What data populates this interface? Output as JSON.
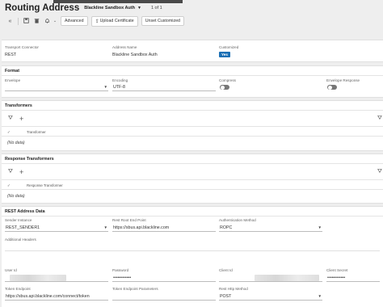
{
  "header": {
    "title": "Routing Address",
    "selector": "Blackline Sandbox Auth",
    "pager": "1 of 1"
  },
  "toolbar": {
    "back_icon": "chevron-double-left-icon",
    "save_icon": "save-icon",
    "delete_icon": "trash-icon",
    "bell_icon": "bell-icon",
    "advanced": "Advanced",
    "upload": "Upload Certificate",
    "unset": "Unset Customized"
  },
  "general": {
    "transport_connector_label": "Transport Connector",
    "transport_connector_value": "REST",
    "address_name_label": "Address Name",
    "address_name_value": "Blackline Sandbox Auth",
    "customized_label": "Customized",
    "customized_value": "Yes"
  },
  "format": {
    "title": "Format",
    "envelope_label": "Envelope",
    "envelope_value": "",
    "encoding_label": "Encoding",
    "encoding_value": "UTF-8",
    "compress_label": "Compress",
    "compress_on": false,
    "envelope_response_label": "Envelope Response",
    "envelope_response_on": false
  },
  "transformers": {
    "title": "Transformers",
    "col": "Transformer",
    "empty": "(No data)"
  },
  "response_transformers": {
    "title": "Response Transformers",
    "col": "Response Transformer",
    "empty": "(No data)"
  },
  "rest": {
    "title": "REST Address Data",
    "sender_instance_label": "Sender Instance",
    "sender_instance_value": "REST_SENDER1",
    "root_endpoint_label": "Rest Root End Point",
    "root_endpoint_value": "https://sbus.api.blackline.com",
    "auth_method_label": "Authentication Method",
    "auth_method_value": "ROPC",
    "additional_headers_label": "Additional Headers",
    "user_id_label": "User Id",
    "password_label": "Password",
    "password_value": "••••••••••••",
    "client_id_label": "Client Id",
    "client_secret_label": "Client Secret",
    "client_secret_value": "••••••••••••",
    "token_endpoint_label": "Token Endpoint",
    "token_endpoint_value": "https://sbus.api.blackline.com/connect/token",
    "token_params_label": "Token Endpoint Parameters",
    "http_method_label": "Rest Http Method",
    "http_method_value": "POST"
  },
  "colors": {
    "accent": "#1a6fb5",
    "toggle_off": "#777777",
    "page_bg": "#eeeeee"
  }
}
